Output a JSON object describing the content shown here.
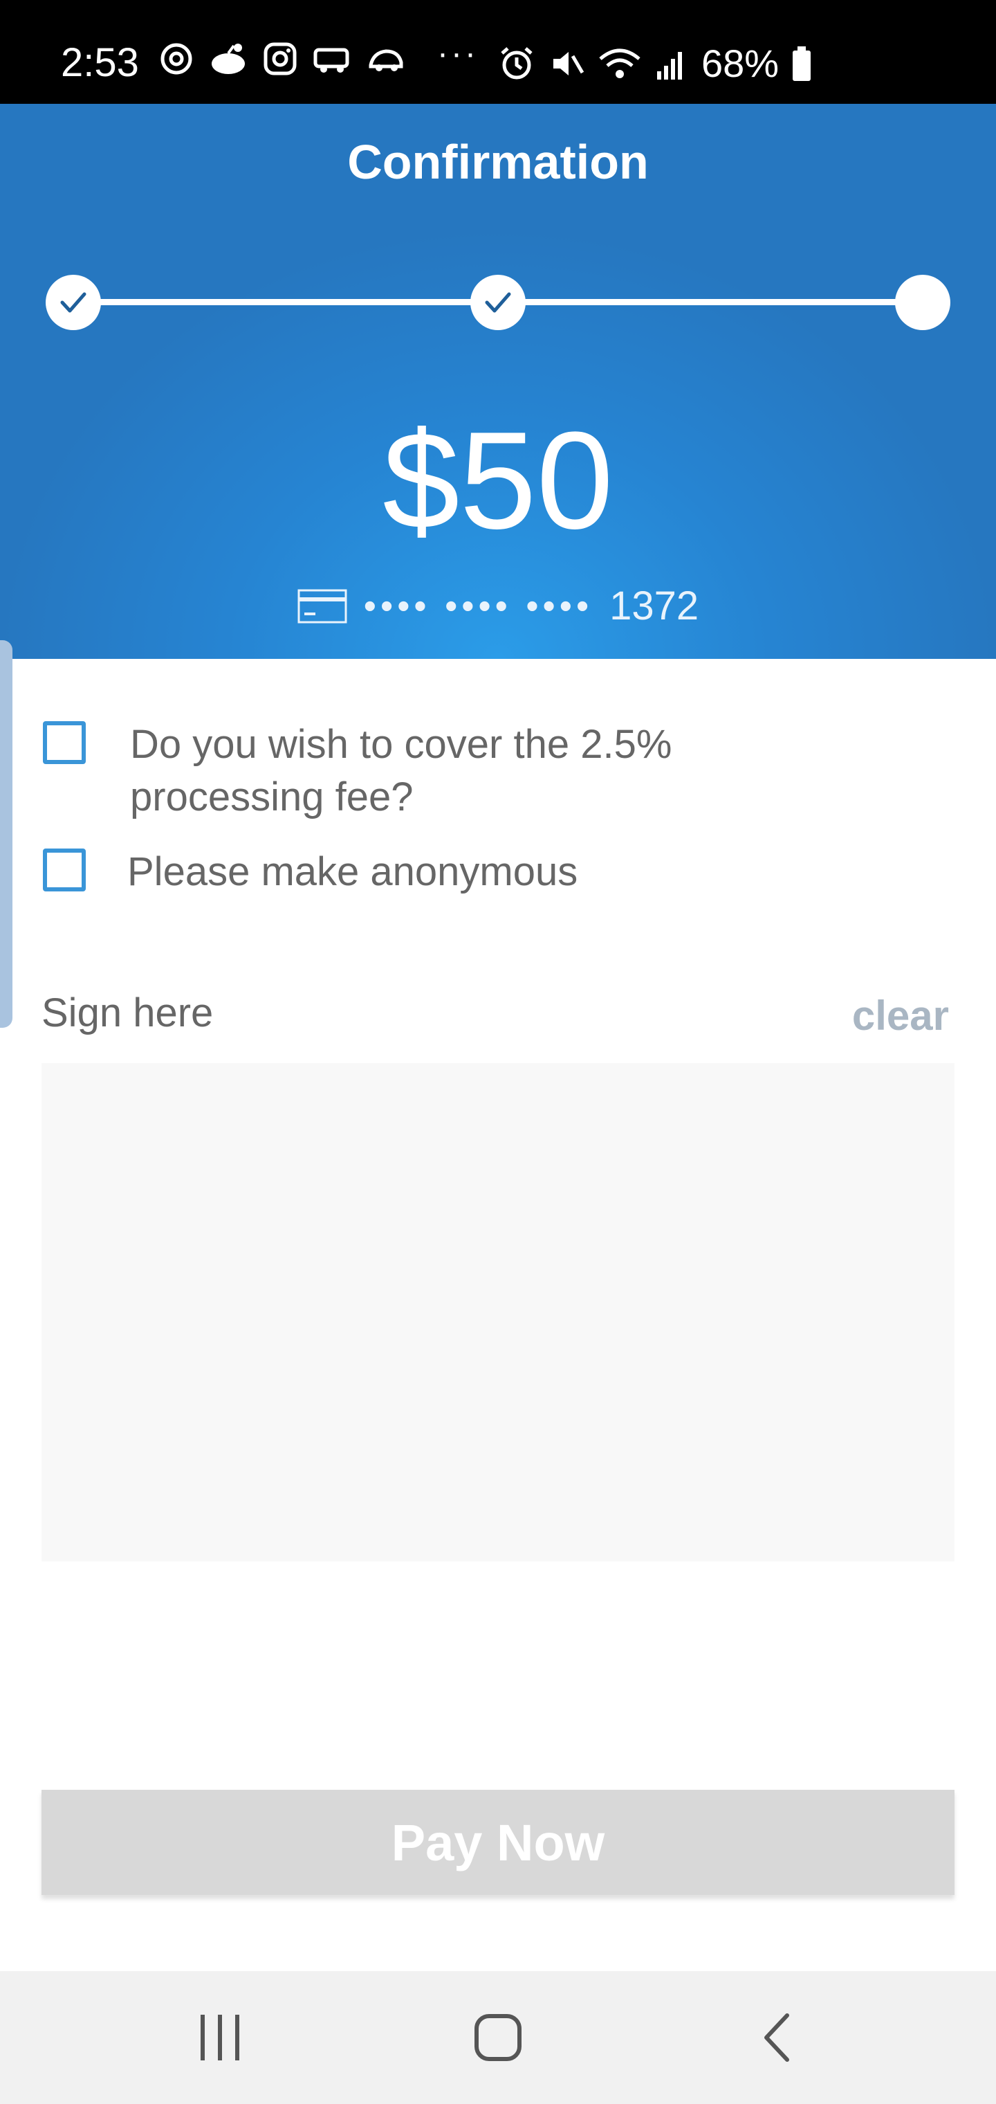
{
  "status_bar": {
    "time": "2:53",
    "battery_percent": "68%",
    "overflow_indicator": "···",
    "left_icons": [
      "threads-icon",
      "reddit-icon",
      "instagram-icon",
      "van-icon",
      "car-icon"
    ],
    "right_icons": [
      "alarm-icon",
      "mute-icon",
      "wifi-icon",
      "signal-icon",
      "battery-icon"
    ]
  },
  "header": {
    "title": "Confirmation",
    "background_color": "#2684d2",
    "steps": [
      {
        "state": "complete",
        "icon": "check-icon"
      },
      {
        "state": "complete",
        "icon": "check-icon"
      },
      {
        "state": "current"
      }
    ],
    "amount": "$50",
    "card": {
      "icon": "credit-card-icon",
      "masked_groups": "•••• •••• ••••",
      "last4": "1372"
    }
  },
  "options": {
    "cover_fee": {
      "label_line1": "Do you wish to cover the 2.5%",
      "label_line2": "processing fee?",
      "checked": false
    },
    "anonymous": {
      "label": "Please make anonymous",
      "checked": false
    }
  },
  "signature": {
    "label": "Sign here",
    "clear_label": "clear"
  },
  "pay_button": {
    "label": "Pay Now",
    "enabled": false,
    "color": "#d8d8d8"
  },
  "nav_bar": {
    "buttons": [
      "recent-apps-icon",
      "home-icon",
      "back-icon"
    ]
  },
  "colors": {
    "accent": "#3a95d8",
    "text_muted": "#666666",
    "link_disabled": "#a9b6c3"
  }
}
